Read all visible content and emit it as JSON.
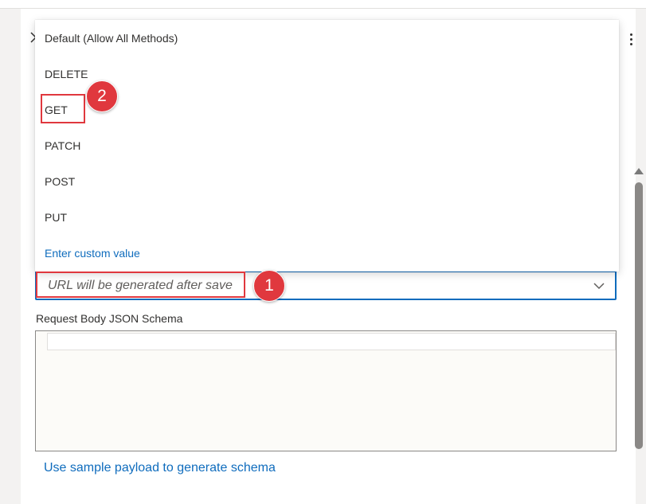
{
  "method_menu": {
    "items": [
      {
        "label": "Default (Allow All Methods)"
      },
      {
        "label": "DELETE"
      },
      {
        "label": "GET"
      },
      {
        "label": "PATCH"
      },
      {
        "label": "POST"
      },
      {
        "label": "PUT"
      }
    ],
    "custom_value_label": "Enter custom value"
  },
  "url_field": {
    "placeholder": "URL will be generated after save"
  },
  "annotations": {
    "step1": "1",
    "step2": "2"
  },
  "schema": {
    "label": "Request Body JSON Schema",
    "value": ""
  },
  "sample_payload_link": "Use sample payload to generate schema",
  "colors": {
    "accent": "#0f6cbd",
    "highlight": "#e0383e"
  },
  "icons": [
    "chevron-right-icon",
    "more-vertical-icon",
    "chevron-down-icon",
    "scroll-up-icon"
  ]
}
